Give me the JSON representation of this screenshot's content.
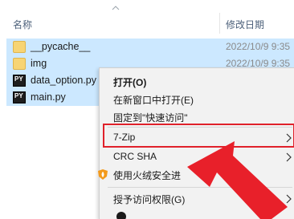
{
  "header": {
    "name_label": "名称",
    "date_label": "修改日期"
  },
  "files": [
    {
      "name": "__pycache__",
      "date": "2022/10/9 9:35",
      "icon": "folder-icon"
    },
    {
      "name": "img",
      "date": "2022/10/9 9:35",
      "icon": "folder-icon"
    },
    {
      "name": "data_option.py",
      "date": "",
      "icon": "python-file-icon"
    },
    {
      "name": "main.py",
      "date": "",
      "icon": "python-file-icon"
    }
  ],
  "context_menu": {
    "items": [
      {
        "label": "打开(O)",
        "bold": true
      },
      {
        "label": "在新窗口中打开(E)"
      },
      {
        "label": "固定到\"快速访问\""
      },
      {
        "label": "7-Zip",
        "submenu": true
      },
      {
        "label": "CRC SHA",
        "submenu": true
      },
      {
        "label": "使用火绒安全进",
        "icon": "huorong-shield-icon"
      },
      {
        "label": "授予访问权限(G)",
        "submenu": true
      }
    ]
  },
  "colors": {
    "selection": "#cce8ff",
    "highlight_border": "#e0212b",
    "arrow": "#e8202a"
  }
}
